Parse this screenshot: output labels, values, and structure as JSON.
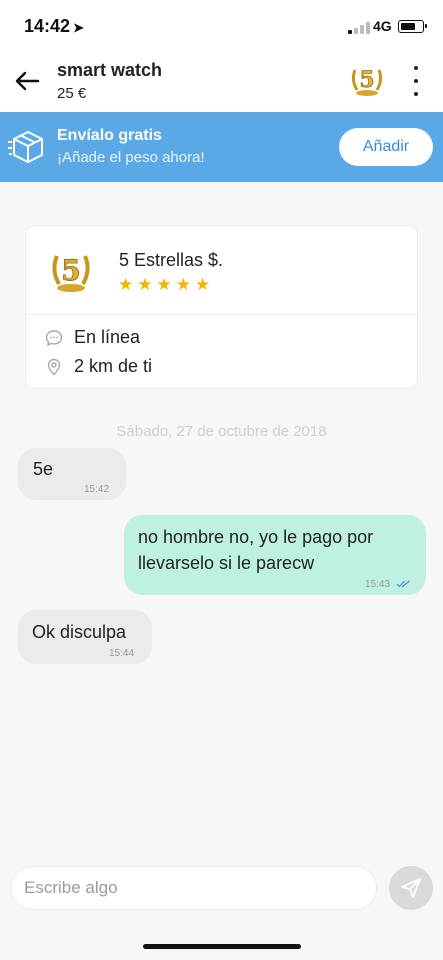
{
  "status_bar": {
    "time": "14:42",
    "network": "4G",
    "signal_bars_on": 1,
    "signal_bars_total": 4,
    "battery_level_percent": 70
  },
  "header": {
    "title": "smart watch",
    "price": "25 €",
    "back_icon": "arrow-left-icon",
    "more_icon": "more-vertical-icon"
  },
  "shipping_banner": {
    "title": "Envíalo gratis",
    "subtitle": "¡Añade el peso ahora!",
    "button_label": "Añadir",
    "icon": "package-icon",
    "color": "#5aa9e6"
  },
  "profile_card": {
    "name": "5 Estrellas $.",
    "rating_stars": 5,
    "status": "En línea",
    "distance": "2 km de ti",
    "status_icon": "chat-bubble-icon",
    "location_icon": "location-pin-icon",
    "star_color": "#f4b400"
  },
  "chat": {
    "date": "Sábado, 27 de octubre de 2018",
    "messages": [
      {
        "direction": "in",
        "text": "5e",
        "time": "15:42"
      },
      {
        "direction": "out",
        "text": "no hombre no, yo le pago por llevarselo si le parecw",
        "time": "15:43",
        "read": true
      },
      {
        "direction": "in",
        "text": "Ok disculpa",
        "time": "15:44"
      }
    ],
    "incoming_color": "#ebebeb",
    "outgoing_color": "#bff1e0"
  },
  "composer": {
    "placeholder": "Escribe algo",
    "value": "",
    "send_icon": "send-icon"
  }
}
